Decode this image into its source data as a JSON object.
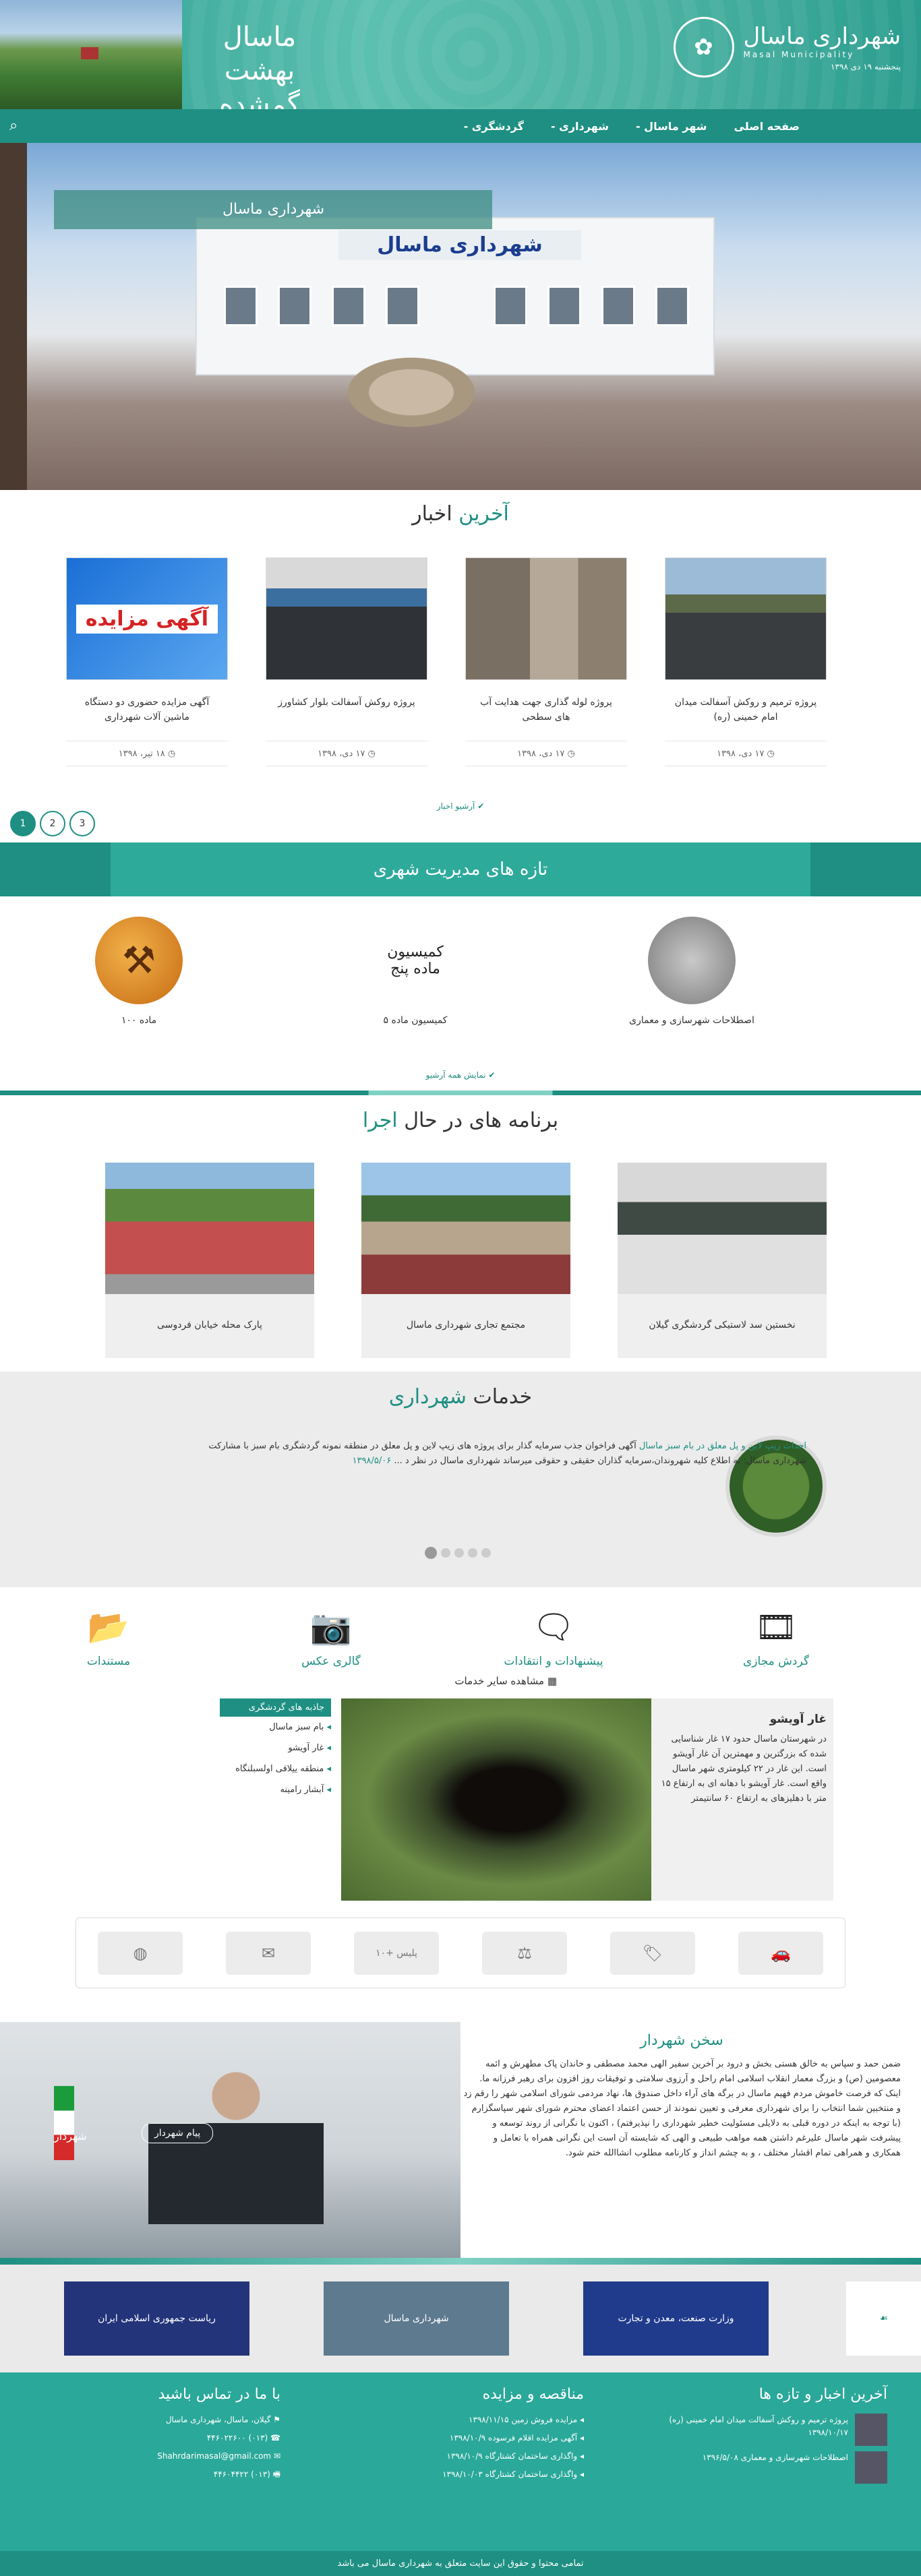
{
  "header": {
    "logo_title": "شهرداری ماسال",
    "logo_subtitle": "Masal Municipality",
    "date": "پنجشنبه ۱۹ دی ۱۳۹۸",
    "slogan": "ماسال بهشت گمشده ایران"
  },
  "nav": {
    "items": [
      "صفحه اصلی",
      "شهر ماسال -",
      "شهرداری -",
      "گردشگری -"
    ],
    "search_icon": "search-icon"
  },
  "hero": {
    "caption": "شهرداری ماسال",
    "building_sign": "شهرداری ماسال"
  },
  "news": {
    "title_part1": "آخرین",
    "title_part2": "اخبار",
    "items": [
      {
        "title": "پروژه ترمیم و روکش آسفالت میدان امام خمینی (ره)",
        "date": "۱۷ دی، ۱۳۹۸"
      },
      {
        "title": "پروژه لوله گذاری جهت هدایت آب های سطحی",
        "date": "۱۷ دی، ۱۳۹۸"
      },
      {
        "title": "پروژه روکش آسفالت بلوار کشاورز",
        "date": "۱۷ دی، ۱۳۹۸"
      },
      {
        "title": "آگهی مزایده حضوری دو دستگاه ماشین آلات شهرداری",
        "date": "۱۸ تیر، ۱۳۹۸"
      }
    ],
    "auction_banner": "آگهی مزایده",
    "archive_link": "آرشیو اخبار",
    "pages": [
      "1",
      "2",
      "3"
    ]
  },
  "urban": {
    "title": "تازه های مدیریت شهری",
    "items": [
      {
        "label": "اصطلاحات شهرسازی و معماری"
      },
      {
        "label": "کمیسیون ماده ۵",
        "logo_text": "کمیسیون ماده پنج"
      },
      {
        "label": "ماده ۱۰۰"
      }
    ],
    "archive_link": "نمایش همه آرشیو"
  },
  "projects": {
    "title_part1": "برنامه های در حال",
    "title_part2": "اجرا",
    "items": [
      {
        "label": "نخستین سد لاستیکی گردشگری گیلان"
      },
      {
        "label": "مجتمع تجاری شهرداری ماسال"
      },
      {
        "label": "پارک محله خیابان فردوسی"
      }
    ]
  },
  "services": {
    "title_part1": "خدمات",
    "title_part2": "شهرداری",
    "link": "احداث زیپ لاین و پل معلق در بام سبز ماسال",
    "text": "آگهی فراخوان جذب سرمایه گذار برای پروژه های زیپ لاین و پل معلق در منطقه نمونه گردشگری بام سبز با مشارکت شهرداری ماسال: به اطلاع کلیه شهروندان،سرمایه گذاران حقیقی و حقوقی میرساند شهرداری ماسال در نظر د ...",
    "date": "۱۳۹۸/۵/۰۶"
  },
  "quick": {
    "icons": [
      {
        "label": "گردش مجازی",
        "icon": "film-icon"
      },
      {
        "label": "پیشنهادات و انتقادات",
        "icon": "chat-icon"
      },
      {
        "label": "گالری عکس",
        "icon": "camera-icon"
      },
      {
        "label": "مستندات",
        "icon": "folder-icon"
      }
    ],
    "more_services": "مشاهده سایر خدمات",
    "cave": {
      "title": "غار آویشو",
      "text": "در شهرستان ماسال حدود ۱۷ غار شناسایی شده که بزرگترین و مهمترین آن غار آویشو است. این غار در ۲۲ کیلومتری شهر ماسال واقع است. غار آویشو با دهانه ای به ارتفاع ۱۵ متر با دهلیزهای به ارتفاع ۶۰ سانتیمتر"
    },
    "attractions": {
      "header": "جاذبه های گردشگری",
      "items": [
        "بام سبز ماسال",
        "غار آویشو",
        "منطقه ییلاقی اولسبلنگاه",
        "آبشار رامینه"
      ]
    },
    "bar_items": [
      "car-icon",
      "tag-icon",
      "scale-icon",
      "پلیس +۱۰",
      "postal-icon",
      "globe-icon"
    ]
  },
  "mayor": {
    "title": "سخن شهردار",
    "text": "ضمن حمد و سپاس به خالق هستی بخش و درود بر آخرین سفیر الهی محمد مصطفی و خاندان پاک مطهرش و ائمه معصومین (ص) و بزرگ معمار انقلاب اسلامی امام راحل و آرزوی سلامتی و توفیقات روز افزون برای رهبر فرزانه ما. اینک که فرصت خاموش مردم فهیم ماسال در برگه های آراء داخل صندوق ها، نهاد مردمی شورای اسلامی شهر را رقم زد و منتخبین شما انتخاب را برای شهرداری معرفی و تعیین نمودند از حسن اعتماد اعضای محترم شورای شهر سپاسگزارم (با توجه به اینکه در دوره قبلی به دلایلی مسئولیت خطیر شهرداری را نپذیرفتم) ، اکنون با نگرانی از روند توسعه و پیشرفت شهر ماسال علیرغم داشتن همه مواهب طبیعی و الهی که شایسته آن است این نگرانی همراه با تعامل و همکاری و همراهی تمام اقشار مختلف ، و به چشم انداز و کارنامه مطلوب انشاالله ختم شود.",
    "button": "پیام شهردار",
    "photo_caption": "شهردار"
  },
  "logos": [
    {
      "label": "وزارت صنعت، معدن و تجارت"
    },
    {
      "label": "شهرداری ماسال"
    },
    {
      "label": "ریاست جمهوری اسلامی ایران"
    }
  ],
  "footer": {
    "news_title": "آخرین اخبار و تازه ها",
    "news": [
      {
        "title": "پروژه ترمیم و روکش آسفالت میدان امام خمینی (ره) ۱۳۹۸/۱۰/۱۷"
      },
      {
        "title": "اصطلاحات شهرسازی و معماری ۱۳۹۶/۵/۰۸"
      }
    ],
    "tender_title": "مناقصه و مزایده",
    "tenders": [
      "مزایده فروش زمین ۱۳۹۸/۱۱/۱۵",
      "آگهی مزایده اقلام فرسوده ۱۳۹۸/۱۰/۹",
      "واگذاری ساختمان کشتارگاه ۱۳۹۸/۱۰/۹",
      "واگذاری ساختمان کشتارگاه ۱۳۹۸/۱۰/۰۳"
    ],
    "contact_title": "با ما در تماس باشید",
    "address": "گیلان، ماسال، شهرداری ماسال",
    "phone": "(۰۱۳) ۴۴۶۰۲۲۶۰۰",
    "email": "Shahrdarimasal@gmail.com",
    "fax": "(۰۱۳) ۴۴۶۰۴۴۲۲"
  },
  "copyright": "تمامی محتوا و حقوق این سایت متعلق به شهرداری ماسال می باشد"
}
